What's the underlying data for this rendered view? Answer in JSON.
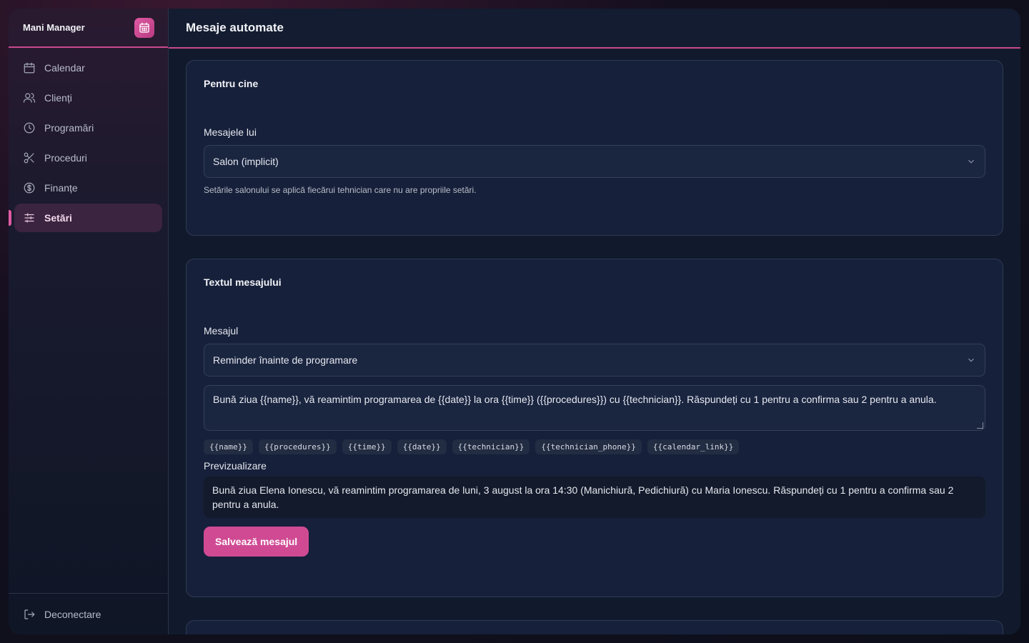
{
  "app": {
    "brand": "Mani Manager"
  },
  "sidebar": {
    "items": [
      {
        "label": "Calendar",
        "icon": "calendar-icon"
      },
      {
        "label": "Clienți",
        "icon": "users-icon"
      },
      {
        "label": "Programări",
        "icon": "clock-icon"
      },
      {
        "label": "Proceduri",
        "icon": "scissors-icon"
      },
      {
        "label": "Finanțe",
        "icon": "dollar-icon"
      },
      {
        "label": "Setări",
        "icon": "sliders-icon",
        "active": true
      }
    ],
    "logout": "Deconectare"
  },
  "header": {
    "title": "Mesaje automate"
  },
  "audience": {
    "title": "Pentru cine",
    "label": "Mesajele lui",
    "selected": "Salon (implicit)",
    "help": "Setările salonului se aplică fiecărui tehnician care nu are propriile setări."
  },
  "message": {
    "title": "Textul mesajului",
    "label": "Mesajul",
    "selected": "Reminder înainte de programare",
    "template": "Bună ziua {{name}}, vă reamintim programarea de {{date}} la ora {{time}} ({{procedures}}) cu {{technician}}. Răspundeți cu 1 pentru a confirma sau 2 pentru a anula.",
    "variables": [
      "{{name}}",
      "{{procedures}}",
      "{{time}}",
      "{{date}}",
      "{{technician}}",
      "{{technician_phone}}",
      "{{calendar_link}}"
    ],
    "preview_label": "Previzualizare",
    "preview": "Bună ziua Elena Ionescu, vă reamintim programarea de luni, 3 august la ora 14:30 (Manichiură, Pedichiură) cu Maria Ionescu. Răspundeți cu 1 pentru a confirma sau 2 pentru a anula.",
    "save_label": "Salvează mesajul"
  },
  "colors": {
    "accent": "#d04a93",
    "background": "#111a2d"
  }
}
